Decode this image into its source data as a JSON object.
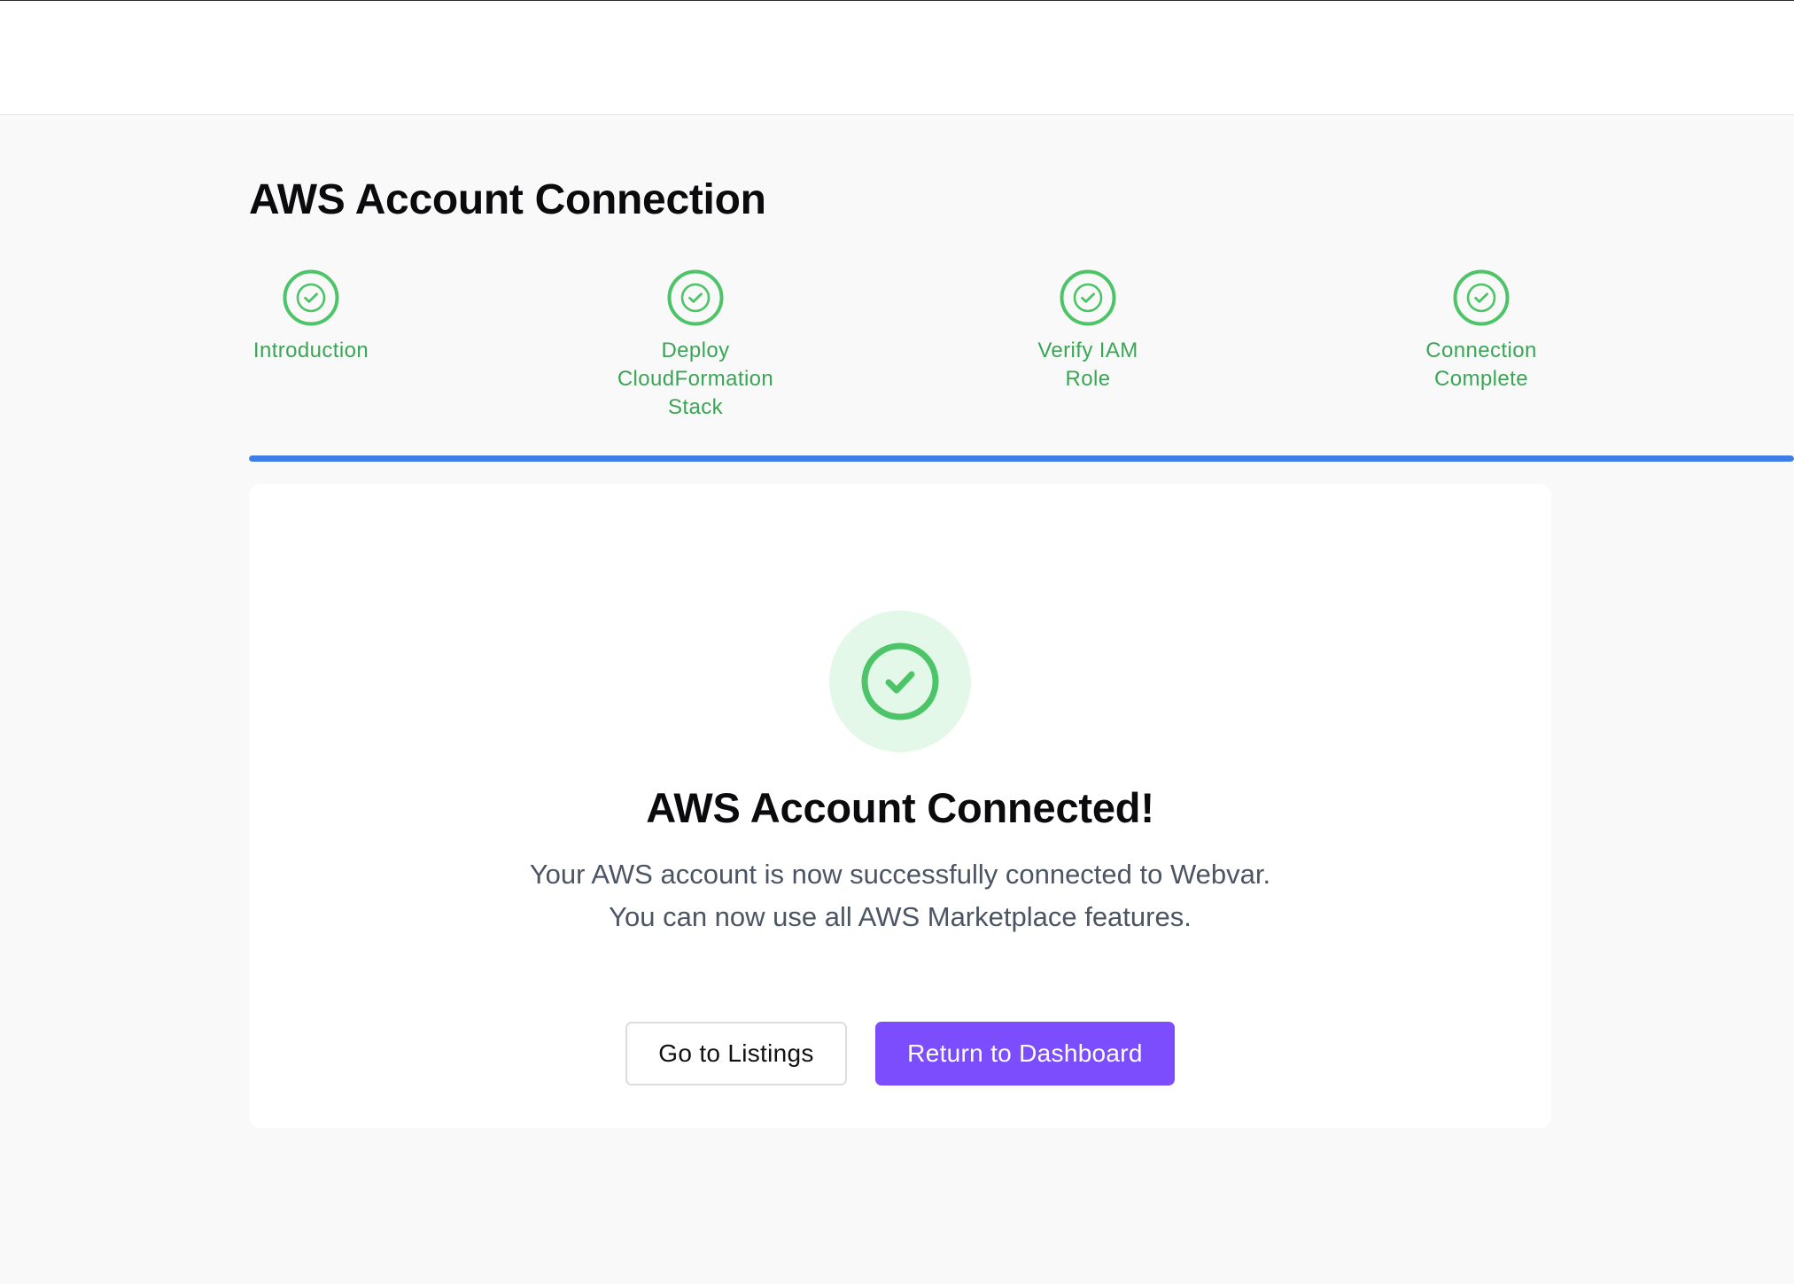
{
  "page": {
    "title": "AWS Account Connection"
  },
  "steps": [
    {
      "label": "Introduction",
      "status": "complete",
      "icon": "check-circle-icon"
    },
    {
      "label": "Deploy CloudFormation Stack",
      "status": "complete",
      "icon": "check-circle-icon"
    },
    {
      "label": "Verify IAM Role",
      "status": "complete",
      "icon": "check-circle-icon"
    },
    {
      "label": "Connection Complete",
      "status": "complete",
      "icon": "check-circle-icon"
    }
  ],
  "progress": {
    "fraction": 1.0
  },
  "success": {
    "icon": "check-circle-icon",
    "title": "AWS Account Connected!",
    "message_line1": "Your AWS account is now successfully connected to Webvar.",
    "message_line2": "You can now use all AWS Marketplace features."
  },
  "actions": {
    "secondary_label": "Go to Listings",
    "primary_label": "Return to Dashboard"
  },
  "colors": {
    "accent_green": "#3aa655",
    "progress_blue": "#3f7de8",
    "primary_button": "#7c4dfc",
    "success_badge_bg": "#e3f8e8"
  }
}
